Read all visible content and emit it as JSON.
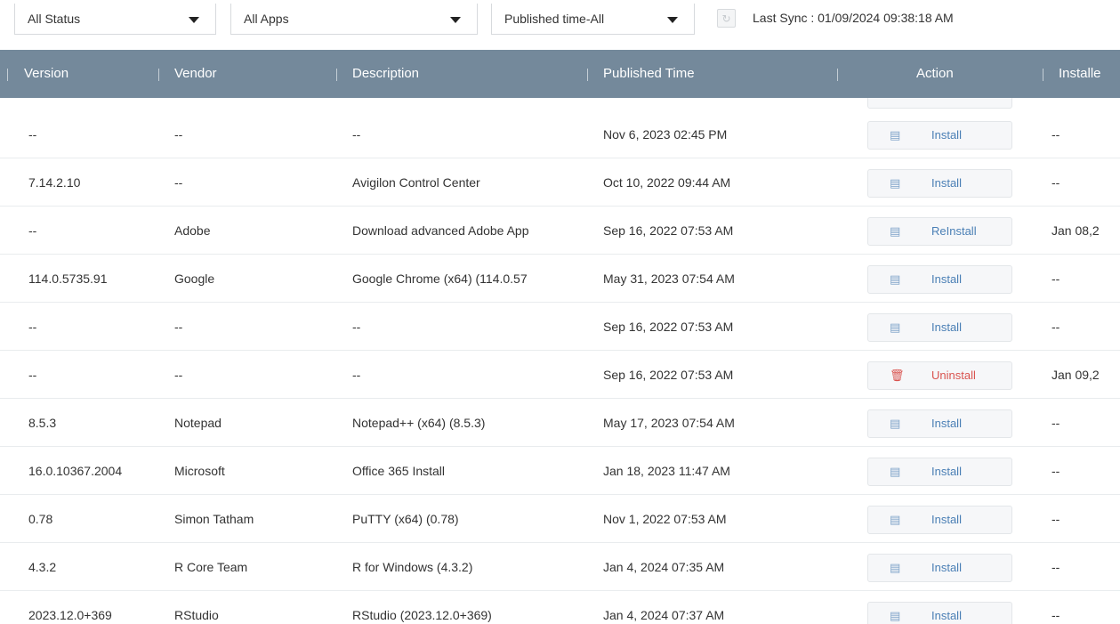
{
  "filters": {
    "status": "All Status",
    "apps": "All Apps",
    "published_time": "Published time-All",
    "last_sync": "Last Sync : 01/09/2024 09:38:18 AM"
  },
  "columns": {
    "version": "Version",
    "vendor": "Vendor",
    "description": "Description",
    "published_time": "Published Time",
    "action": "Action",
    "installed": "Installe"
  },
  "rows": [
    {
      "version": "--",
      "vendor": "--",
      "description": "--",
      "published": "Nov 6, 2023 02:45 PM",
      "action": "Install",
      "action_icon": "install-icon",
      "installed": "--"
    },
    {
      "version": "7.14.2.10",
      "vendor": "--",
      "description": "Avigilon Control Center",
      "published": "Oct 10, 2022 09:44 AM",
      "action": "Install",
      "action_icon": "install-icon",
      "installed": "--"
    },
    {
      "version": "--",
      "vendor": "Adobe",
      "description": "Download advanced Adobe App",
      "published": "Sep 16, 2022 07:53 AM",
      "action": "ReInstall",
      "action_icon": "install-icon",
      "installed": "Jan 08,2"
    },
    {
      "version": "114.0.5735.91",
      "vendor": "Google",
      "description": "Google Chrome (x64) (114.0.57",
      "published": "May 31, 2023 07:54 AM",
      "action": "Install",
      "action_icon": "install-icon",
      "installed": "--"
    },
    {
      "version": "--",
      "vendor": "--",
      "description": "--",
      "published": "Sep 16, 2022 07:53 AM",
      "action": "Install",
      "action_icon": "install-icon",
      "installed": "--"
    },
    {
      "version": "--",
      "vendor": "--",
      "description": "--",
      "published": "Sep 16, 2022 07:53 AM",
      "action": "Uninstall",
      "action_icon": "trash-icon",
      "installed": "Jan 09,2"
    },
    {
      "version": "8.5.3",
      "vendor": "Notepad",
      "description": "Notepad++ (x64) (8.5.3)",
      "published": "May 17, 2023 07:54 AM",
      "action": "Install",
      "action_icon": "install-icon",
      "installed": "--"
    },
    {
      "version": "16.0.10367.2004",
      "vendor": "Microsoft",
      "description": "Office 365 Install",
      "published": "Jan 18, 2023 11:47 AM",
      "action": "Install",
      "action_icon": "install-icon",
      "installed": "--"
    },
    {
      "version": "0.78",
      "vendor": "Simon Tatham",
      "description": "PuTTY (x64) (0.78)",
      "published": "Nov 1, 2022 07:53 AM",
      "action": "Install",
      "action_icon": "install-icon",
      "installed": "--"
    },
    {
      "version": "4.3.2",
      "vendor": "R Core Team",
      "description": "R for Windows (4.3.2)",
      "published": "Jan 4, 2024 07:35 AM",
      "action": "Install",
      "action_icon": "install-icon",
      "installed": "--"
    },
    {
      "version": "2023.12.0+369",
      "vendor": "RStudio",
      "description": "RStudio (2023.12.0+369)",
      "published": "Jan 4, 2024 07:37 AM",
      "action": "Install",
      "action_icon": "install-icon",
      "installed": "--"
    }
  ],
  "colors": {
    "header_bg": "#74899b",
    "action_text": "#4a7fb5",
    "danger_text": "#d9534f"
  }
}
